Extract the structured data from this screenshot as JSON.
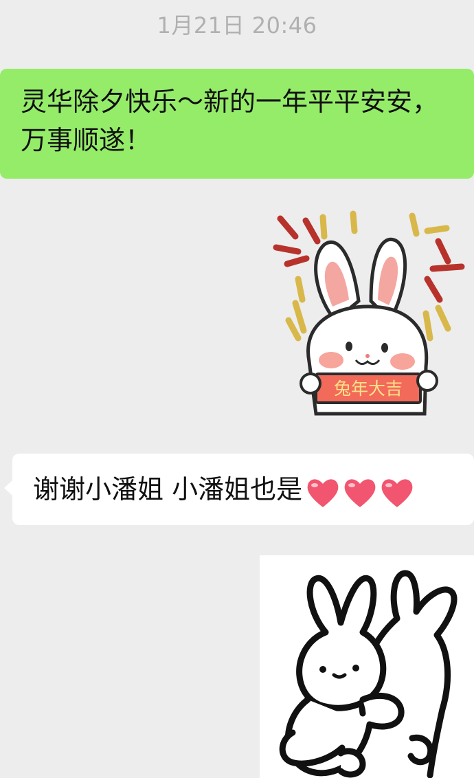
{
  "chat": {
    "timestamp": "1月21日 20:46",
    "outgoing_message": "灵华除夕快乐～新的一年平平安安，万事顺遂！",
    "incoming_message": "谢谢小潘姐 小潘姐也是",
    "incoming_emoji": [
      "heart-emoji",
      "heart-emoji",
      "heart-emoji"
    ],
    "sticker_1": {
      "icon": "rabbit-new-year-sticker",
      "banner_text": "兔年大吉"
    },
    "sticker_2": {
      "icon": "rabbits-hug-sticker"
    }
  },
  "colors": {
    "background": "#ededed",
    "outgoing_bubble": "#95ec69",
    "incoming_bubble": "#ffffff",
    "timestamp_text": "#b0b0b0",
    "heart": "#f2556f",
    "banner": "#f26a5a"
  }
}
